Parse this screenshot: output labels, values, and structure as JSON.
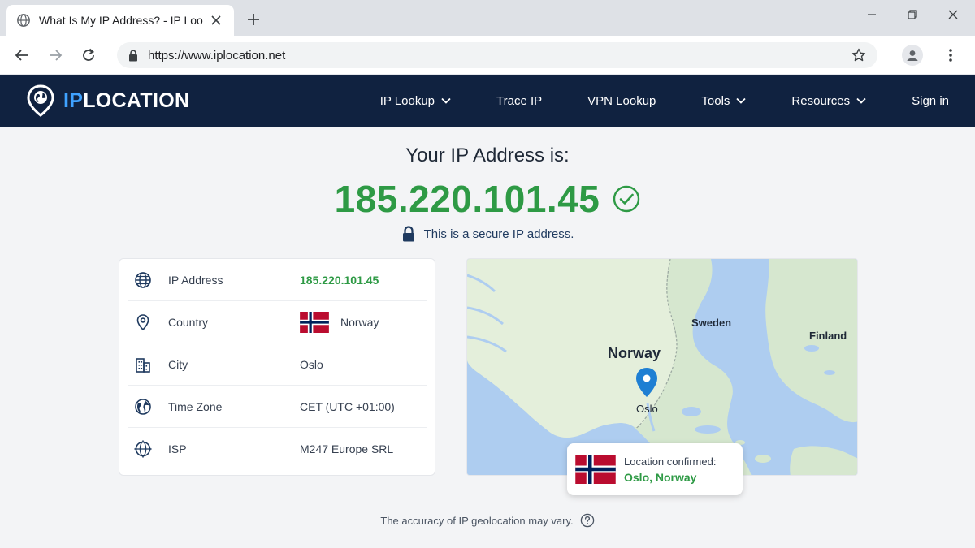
{
  "browser": {
    "tab_title": "What Is My IP Address? - IP Lookup",
    "url": "https://www.iplocation.net",
    "icons": [
      "globe-icon",
      "close-icon",
      "plus-icon",
      "minimize-icon",
      "restore-icon",
      "close-window-icon",
      "back-icon",
      "forward-icon",
      "reload-icon",
      "lock-icon",
      "star-icon",
      "profile-icon",
      "kebab-menu-icon"
    ]
  },
  "site": {
    "logo_ip": "IP",
    "logo_rest": "LOCATION",
    "nav": [
      {
        "label": "IP Lookup",
        "dropdown": true
      },
      {
        "label": "Trace IP",
        "dropdown": false
      },
      {
        "label": "VPN Lookup",
        "dropdown": false
      },
      {
        "label": "Tools",
        "dropdown": true
      },
      {
        "label": "Resources",
        "dropdown": true
      },
      {
        "label": "Sign in",
        "dropdown": false
      }
    ]
  },
  "hero": {
    "title": "Your IP Address is:",
    "ip": "185.220.101.45",
    "secure_text": "This is a secure IP address."
  },
  "info": {
    "rows": [
      {
        "icon": "globe-icon",
        "label": "IP Address",
        "value": "185.220.101.45"
      },
      {
        "icon": "location-pin-icon",
        "label": "Country",
        "value": "Norway"
      },
      {
        "icon": "building-icon",
        "label": "City",
        "value": "Oslo"
      },
      {
        "icon": "earth-icon",
        "label": "Time Zone",
        "value": "CET (UTC +01:00)"
      },
      {
        "icon": "network-globe-icon",
        "label": "ISP",
        "value": "M247 Europe SRL"
      }
    ]
  },
  "map": {
    "labels": {
      "norway": "Norway",
      "sweden": "Sweden",
      "finland": "Finland",
      "oslo": "Oslo"
    },
    "confirm_label": "Location confirmed:",
    "confirm_value": "Oslo, Norway"
  },
  "footer": {
    "note": "The accuracy of IP geolocation may vary."
  },
  "colors": {
    "header_bg": "#102240",
    "accent_blue": "#3fa2ff",
    "ip_green": "#2e9a45",
    "flag_red": "#ba0c2f",
    "flag_blue": "#00205b"
  }
}
